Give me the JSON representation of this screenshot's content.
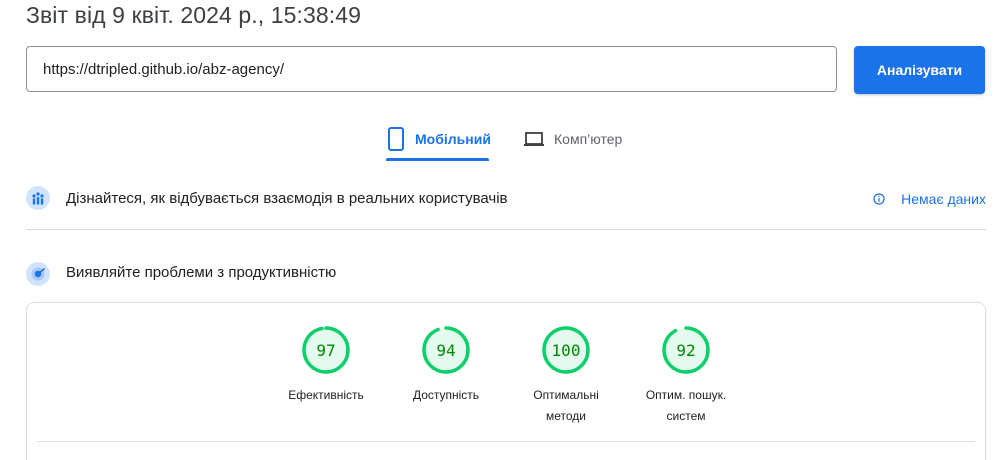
{
  "report": {
    "title": "Звіт від 9 квіт. 2024 р., 15:38:49"
  },
  "search": {
    "url_value": "https://dtripled.github.io/abz-agency/",
    "analyze_label": "Аналізувати"
  },
  "tabs": [
    {
      "label": "Мобільний",
      "icon": "smartphone-icon",
      "active": true
    },
    {
      "label": "Комп’ютер",
      "icon": "laptop-icon",
      "active": false
    }
  ],
  "crux": {
    "text": "Дізнайтеся, як відбувається взаємодія в реальних користувачів",
    "no_data_label": "Немає даних"
  },
  "diagnose": {
    "text": "Виявляйте проблеми з продуктивністю"
  },
  "scores": [
    {
      "value": 97,
      "label": "Ефективність"
    },
    {
      "value": 94,
      "label": "Доступність"
    },
    {
      "value": 100,
      "label": "Оптимальні\nметоди"
    },
    {
      "value": 92,
      "label": "Оптим. пошук.\nсистем"
    }
  ],
  "colors": {
    "accent": "#1a73e8",
    "score_pass_stroke": "#0cce6b",
    "score_pass_fill": "#e5faef",
    "score_pass_text": "#008800"
  }
}
